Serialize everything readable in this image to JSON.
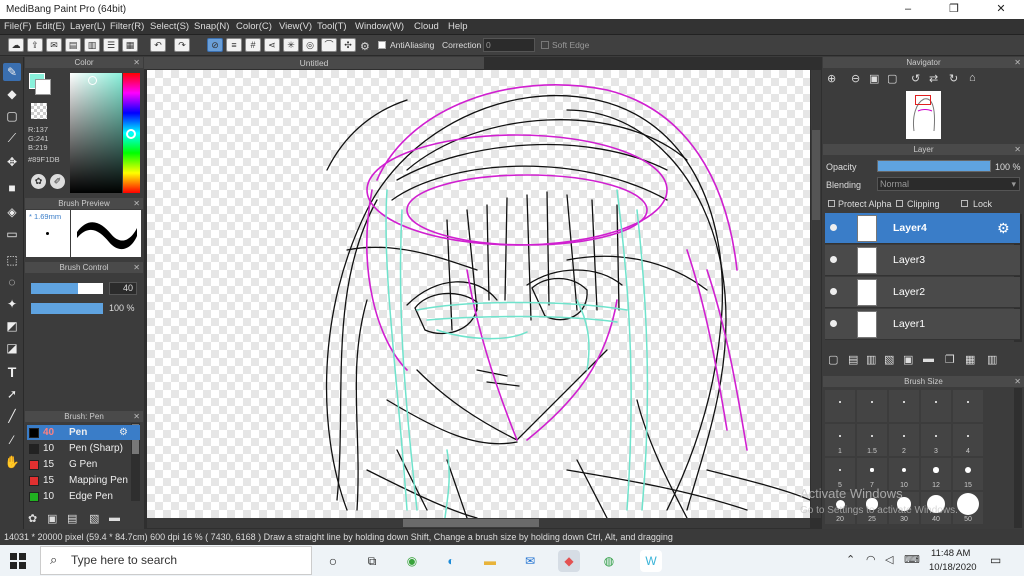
{
  "title_bar": {
    "title": "MediBang Paint Pro (64bit)",
    "minimize": "–",
    "maximize": "❐",
    "close": "✕"
  },
  "menu": [
    "File(F)",
    "Edit(E)",
    "Layer(L)",
    "Filter(R)",
    "Select(S)",
    "Snap(N)",
    "Color(C)",
    "View(V)",
    "Tool(T)",
    "Window(W)",
    "Cloud",
    "Help"
  ],
  "toolbar": {
    "antialiasing_label": "AntiAliasing",
    "correction_label": "Correction",
    "correction_value": "0",
    "soft_edge_label": "Soft Edge"
  },
  "color_panel": {
    "title": "Color",
    "r": "R:137",
    "g": "G:241",
    "b": "B:219",
    "hex": "#89F1DB",
    "color": "#89f1db"
  },
  "brush_preview": {
    "title": "Brush Preview",
    "size": "* 1.69mm"
  },
  "brush_control": {
    "title": "Brush Control",
    "size_value": "40",
    "opacity_value": "100 %"
  },
  "brush_list": {
    "title": "Brush: Pen",
    "items": [
      {
        "size": "40",
        "name": "Pen",
        "color": "#000000",
        "selected": true
      },
      {
        "size": "10",
        "name": "Pen (Sharp)",
        "color": "#222222"
      },
      {
        "size": "15",
        "name": "G Pen",
        "color": "#e03030"
      },
      {
        "size": "15",
        "name": "Mapping Pen",
        "color": "#e03030"
      },
      {
        "size": "10",
        "name": "Edge Pen",
        "color": "#20b020"
      }
    ]
  },
  "canvas": {
    "tab_title": "Untitled"
  },
  "navigator": {
    "title": "Navigator"
  },
  "layer_panel": {
    "title": "Layer",
    "opacity_label": "Opacity",
    "opacity_value": "100 %",
    "opacity_fraction": 1.0,
    "blending_label": "Blending",
    "blending_value": "Normal",
    "protect_alpha": "Protect Alpha",
    "clipping": "Clipping",
    "lock": "Lock",
    "layers": [
      {
        "name": "Layer4",
        "selected": true
      },
      {
        "name": "Layer3"
      },
      {
        "name": "Layer2"
      },
      {
        "name": "Layer1"
      }
    ]
  },
  "brush_size_panel": {
    "title": "Brush Size",
    "sizes": [
      "",
      "",
      "",
      "",
      "",
      "1",
      "1.5",
      "2",
      "3",
      "4",
      "5",
      "7",
      "10",
      "12",
      "15",
      "20",
      "25",
      "30",
      "40",
      "50"
    ]
  },
  "status": {
    "text": "14031 * 20000 pixel   (59.4 * 84.7cm)   600 dpi   16 %   ( 7430, 6168 )   Draw a straight line by holding down Shift, Change a brush size by holding down Ctrl, Alt, and dragging"
  },
  "watermark": {
    "line1": "Activate Windows",
    "line2": "Go to Settings to activate Windows."
  },
  "taskbar": {
    "search_placeholder": "Type here to search",
    "time": "11:48 AM",
    "date": "10/18/2020"
  }
}
